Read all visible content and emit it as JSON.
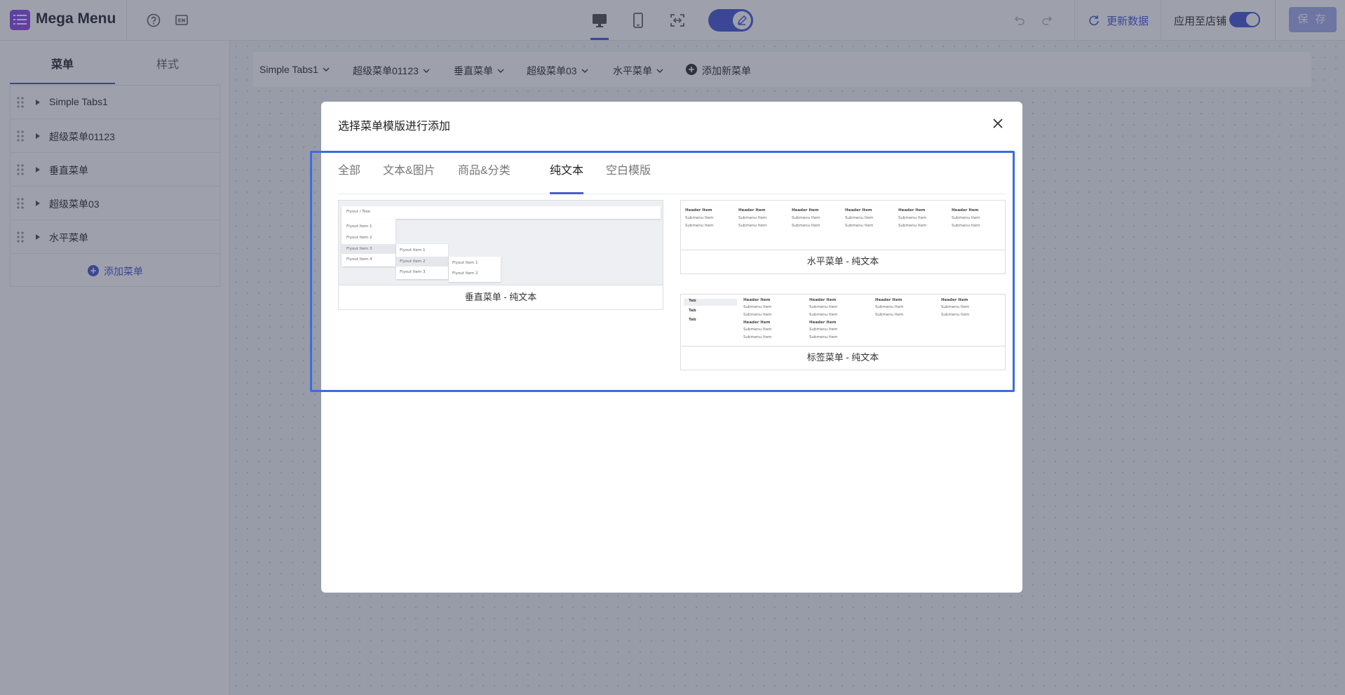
{
  "app": {
    "title": "Mega Menu",
    "lang_badge": "EN"
  },
  "toolbar": {
    "update_label": "更新数据",
    "apply_label": "应用至店铺",
    "save_label": "保 存",
    "colors": {
      "accent": "#4c5bd4",
      "save_disabled": "#a7b0ee"
    }
  },
  "sidebar": {
    "tabs": [
      {
        "label": "菜单"
      },
      {
        "label": "样式"
      }
    ],
    "items": [
      {
        "label": "Simple Tabs1"
      },
      {
        "label": "超级菜单01123"
      },
      {
        "label": "垂直菜单"
      },
      {
        "label": "超级菜单03"
      },
      {
        "label": "水平菜单"
      }
    ],
    "add_label": "添加菜单"
  },
  "menubar": {
    "items": [
      {
        "label": "Simple Tabs1"
      },
      {
        "label": "超级菜单01123"
      },
      {
        "label": "垂直菜单"
      },
      {
        "label": "超级菜单03"
      },
      {
        "label": "水平菜单"
      }
    ],
    "add_label": "添加新菜单"
  },
  "modal": {
    "title": "选择菜单模版进行添加",
    "tabs": [
      {
        "label": "全部"
      },
      {
        "label": "文本&图片"
      },
      {
        "label": "商品&分类"
      },
      {
        "label": "纯文本",
        "active": true
      },
      {
        "label": "空白模版"
      }
    ],
    "cards": [
      {
        "caption": "垂直菜单 - 纯文本",
        "preview": {
          "bar": "Flyout / Tree",
          "col1": [
            "Flyout Item 1",
            "Flyout Item 2",
            "Flyout Item 3",
            "Flyout Item 4"
          ],
          "col2": [
            "Flyout Item 1",
            "Flyout Item 2",
            "Flyout Item 3"
          ],
          "col3": [
            "Flyout Item 1",
            "Flyout Item 2"
          ]
        }
      },
      {
        "caption": "水平菜单 - 纯文本",
        "preview": {
          "header": "Header Item",
          "sub": "Submenu Item"
        }
      },
      {
        "caption": "标签菜单 - 纯文本",
        "preview": {
          "tab": "Tab",
          "header": "Header Item",
          "sub": "Submenu Item"
        }
      }
    ]
  }
}
